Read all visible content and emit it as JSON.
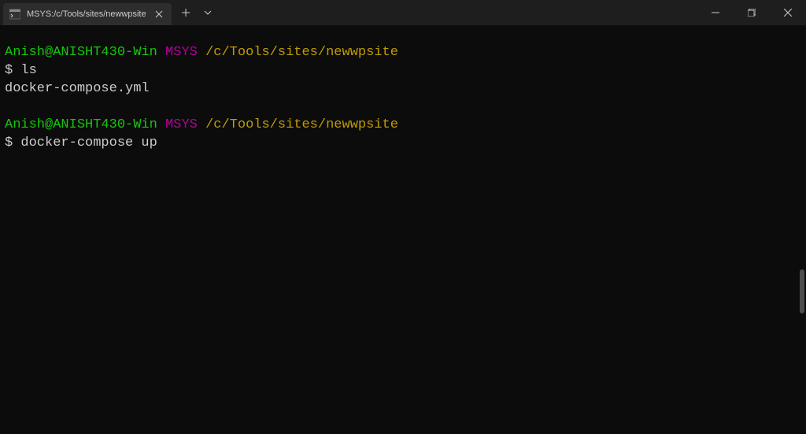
{
  "titlebar": {
    "tab_title": "MSYS:/c/Tools/sites/newwpsite"
  },
  "terminal": {
    "blocks": [
      {
        "user_host": "Anish@ANISHT430-Win",
        "msys": "MSYS",
        "path": "/c/Tools/sites/newwpsite",
        "prompt": "$",
        "command": "ls",
        "output": "docker-compose.yml"
      },
      {
        "user_host": "Anish@ANISHT430-Win",
        "msys": "MSYS",
        "path": "/c/Tools/sites/newwpsite",
        "prompt": "$",
        "command": "docker-compose up",
        "output": ""
      }
    ]
  }
}
